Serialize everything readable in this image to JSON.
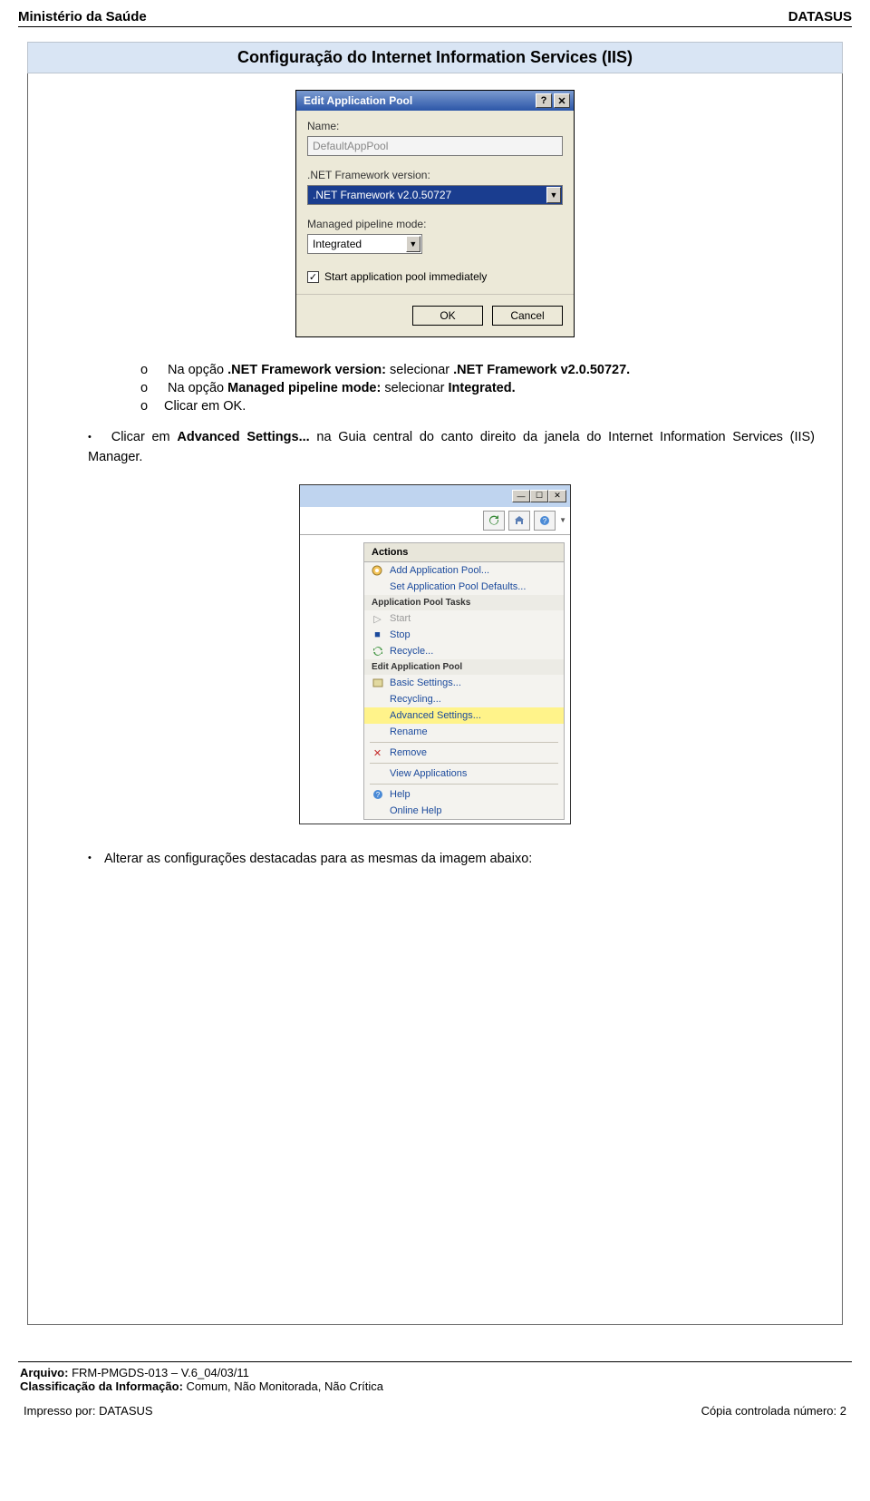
{
  "header": {
    "left": "Ministério da Saúde",
    "right": "DATASUS"
  },
  "doc_title": "Configuração do Internet Information Services (IIS)",
  "dialog1": {
    "title": "Edit Application Pool",
    "name_label": "Name:",
    "name_value": "DefaultAppPool",
    "fw_label": ".NET Framework version:",
    "fw_value": ".NET Framework v2.0.50727",
    "pipe_label": "Managed pipeline mode:",
    "pipe_value": "Integrated",
    "chk_label": "Start application pool immediately",
    "ok": "OK",
    "cancel": "Cancel"
  },
  "instr": {
    "s1_pre": "Na opção ",
    "s1_b": ".NET Framework version:",
    "s1_post": " selecionar ",
    "s1_b2": ".NET Framework v2.0.50727.",
    "s2_pre": "Na opção ",
    "s2_b": "Managed pipeline mode:",
    "s2_post": " selecionar ",
    "s2_b2": "Integrated.",
    "s3": "Clicar em OK.",
    "p1_pre": "Clicar em ",
    "p1_b": "Advanced Settings...",
    "p1_post": " na Guia central do canto direito da janela do Internet Information Services (IIS) Manager.",
    "p2": "Alterar as configurações destacadas para as mesmas da imagem abaixo:"
  },
  "actions": {
    "title": "Actions",
    "add_pool": "Add Application Pool...",
    "set_defaults": "Set Application Pool Defaults...",
    "sec_tasks": "Application Pool Tasks",
    "start": "Start",
    "stop": "Stop",
    "recycle": "Recycle...",
    "sec_edit": "Edit Application Pool",
    "basic": "Basic Settings...",
    "recycling": "Recycling...",
    "advanced": "Advanced Settings...",
    "rename": "Rename",
    "remove": "Remove",
    "view_apps": "View Applications",
    "help": "Help",
    "online_help": "Online Help"
  },
  "footer": {
    "line1_a": "Arquivo: ",
    "line1_b": "FRM-PMGDS-013 – V.6_04/03/11",
    "line2_a": "Classificação da Informação: ",
    "line2_b": "Comum, Não Monitorada, Não Crítica",
    "left_a": "Impresso por: ",
    "left_b": "DATASUS",
    "right_a": "Cópia controlada número: ",
    "right_b": "2"
  }
}
